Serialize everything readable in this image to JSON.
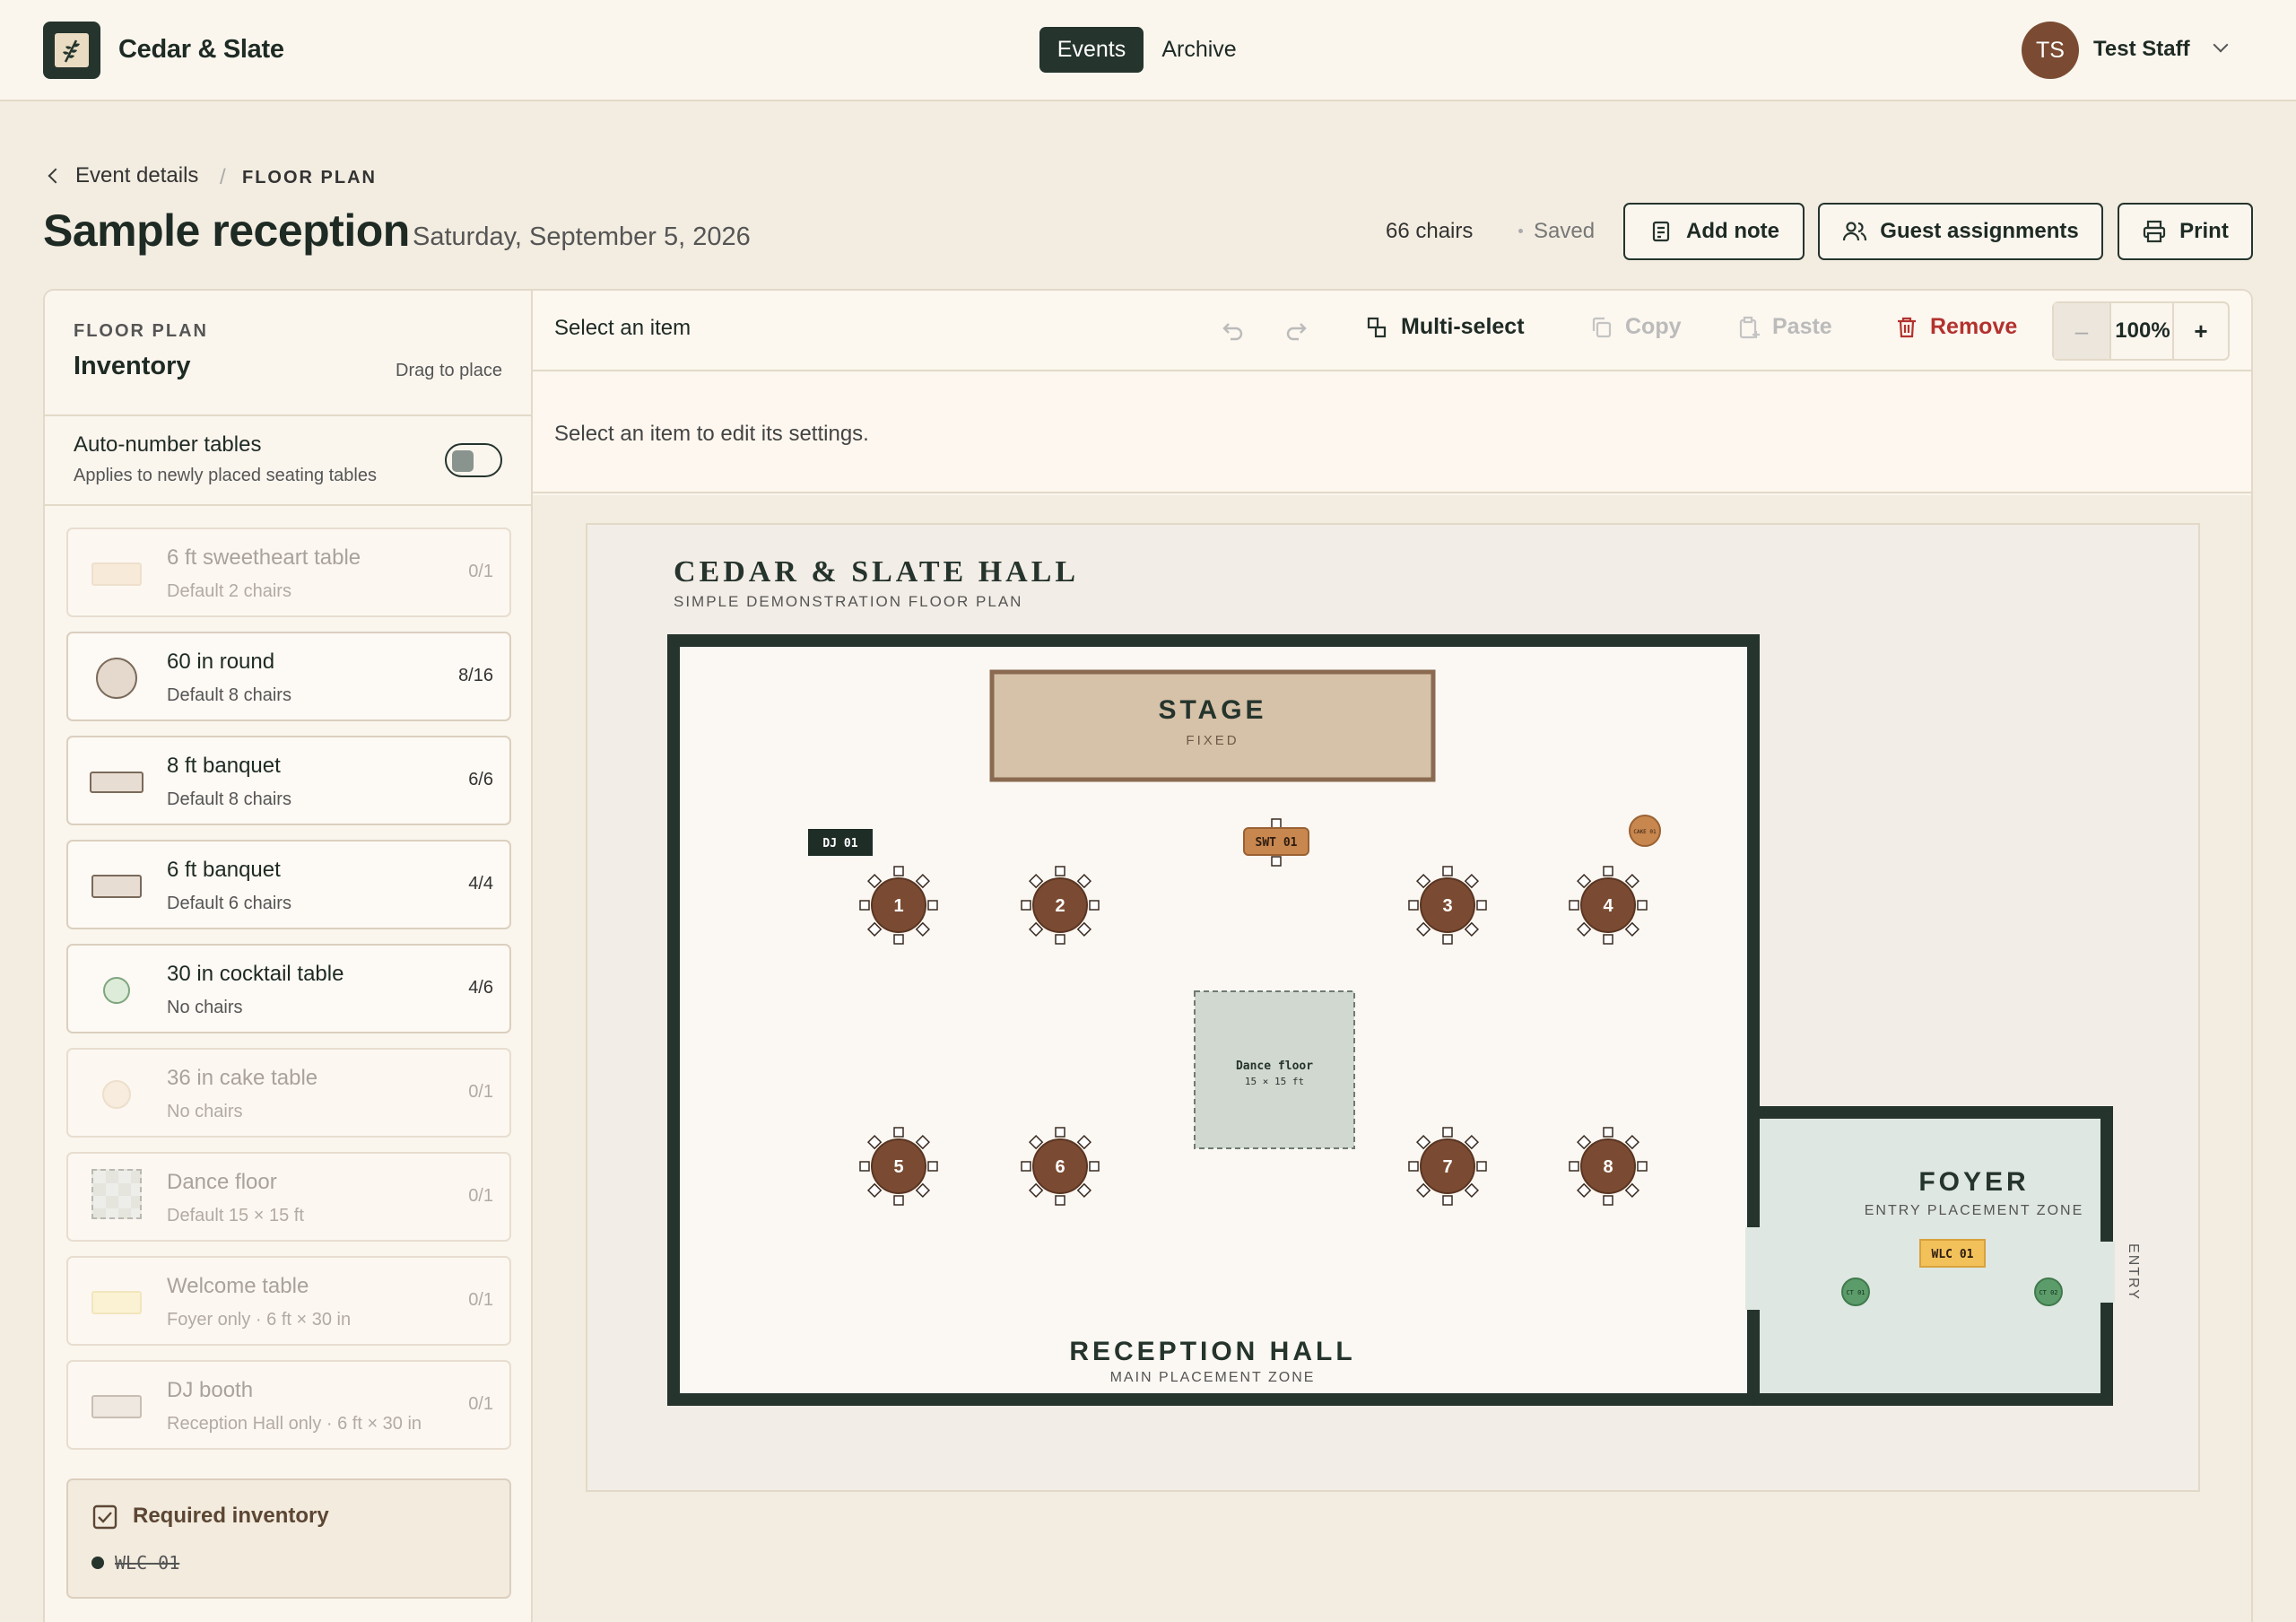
{
  "app": {
    "brand": "Cedar & Slate",
    "nav": [
      {
        "label": "Events",
        "active": true
      },
      {
        "label": "Archive",
        "active": false
      }
    ],
    "user": {
      "initials": "TS",
      "name": "Test Staff"
    }
  },
  "breadcrumb": {
    "back": "Event details",
    "separator": "/",
    "current": "FLOOR PLAN"
  },
  "event": {
    "title": "Sample reception",
    "date": "Saturday, September 5, 2026"
  },
  "status": {
    "chairs": "66 chairs",
    "saved": "Saved"
  },
  "actions": {
    "add_note": "Add note",
    "guest_assignments": "Guest assignments",
    "print": "Print"
  },
  "sidebar": {
    "eyebrow": "FLOOR PLAN",
    "title": "Inventory",
    "hint": "Drag to place",
    "auto_number": {
      "title": "Auto-number tables",
      "subtitle": "Applies to newly placed seating tables",
      "enabled": false
    },
    "items": [
      {
        "name": "6 ft sweetheart table",
        "sub": "Default 2 chairs",
        "count": "0/1",
        "icon": "sweetheart-table-icon"
      },
      {
        "name": "60 in round",
        "sub": "Default 8 chairs",
        "count": "8/16",
        "icon": "round-table-icon"
      },
      {
        "name": "8 ft banquet",
        "sub": "Default 8 chairs",
        "count": "6/6",
        "icon": "banquet-table-icon"
      },
      {
        "name": "6 ft banquet",
        "sub": "Default 6 chairs",
        "count": "4/4",
        "icon": "banquet-table-icon"
      },
      {
        "name": "30 in cocktail table",
        "sub": "No chairs",
        "count": "4/6",
        "icon": "cocktail-table-icon"
      },
      {
        "name": "36 in cake table",
        "sub": "No chairs",
        "count": "0/1",
        "icon": "cake-table-icon"
      },
      {
        "name": "Dance floor",
        "sub": "Default 15 × 15 ft",
        "count": "0/1",
        "icon": "dance-floor-icon"
      },
      {
        "name": "Welcome table",
        "sub": "Foyer only · 6 ft × 30 in",
        "count": "0/1",
        "icon": "welcome-table-icon"
      },
      {
        "name": "DJ booth",
        "sub": "Reception Hall only · 6 ft × 30 in",
        "count": "0/1",
        "icon": "dj-booth-icon"
      }
    ],
    "required": {
      "title": "Required inventory",
      "items": [
        "WLC 01"
      ]
    }
  },
  "toolbar": {
    "selection": "Select an item",
    "multi_select": "Multi-select",
    "copy": "Copy",
    "paste": "Paste",
    "remove": "Remove",
    "zoom_minus": "–",
    "zoom": "100%",
    "zoom_plus": "+"
  },
  "settings": {
    "empty": "Select an item to edit its settings."
  },
  "floorplan": {
    "venue": "CEDAR & SLATE HALL",
    "subtitle": "SIMPLE DEMONSTRATION FLOOR PLAN",
    "stage": {
      "label": "STAGE",
      "sub": "FIXED"
    },
    "reception": {
      "label": "RECEPTION HALL",
      "sub": "MAIN PLACEMENT ZONE"
    },
    "foyer": {
      "label": "FOYER",
      "sub": "ENTRY PLACEMENT ZONE"
    },
    "entry": "ENTRY",
    "dance_floor": {
      "label": "Dance floor",
      "sub": "15 × 15 ft"
    },
    "dj": "DJ 01",
    "sweetheart": "SWT 01",
    "cake": "CAKE 01",
    "welcome": "WLC 01",
    "cocktails": [
      "CT 01",
      "CT 02"
    ],
    "tables": [
      "1",
      "2",
      "3",
      "4",
      "5",
      "6",
      "7",
      "8"
    ]
  },
  "colors": {
    "primary": "#25342d",
    "accent": "#7a4b32",
    "remove": "#b3322e",
    "foyer": "#dfe7e2",
    "stage": "#d6c2a8",
    "welcome": "#f2c15a",
    "cocktail": "#5c9c6a"
  }
}
